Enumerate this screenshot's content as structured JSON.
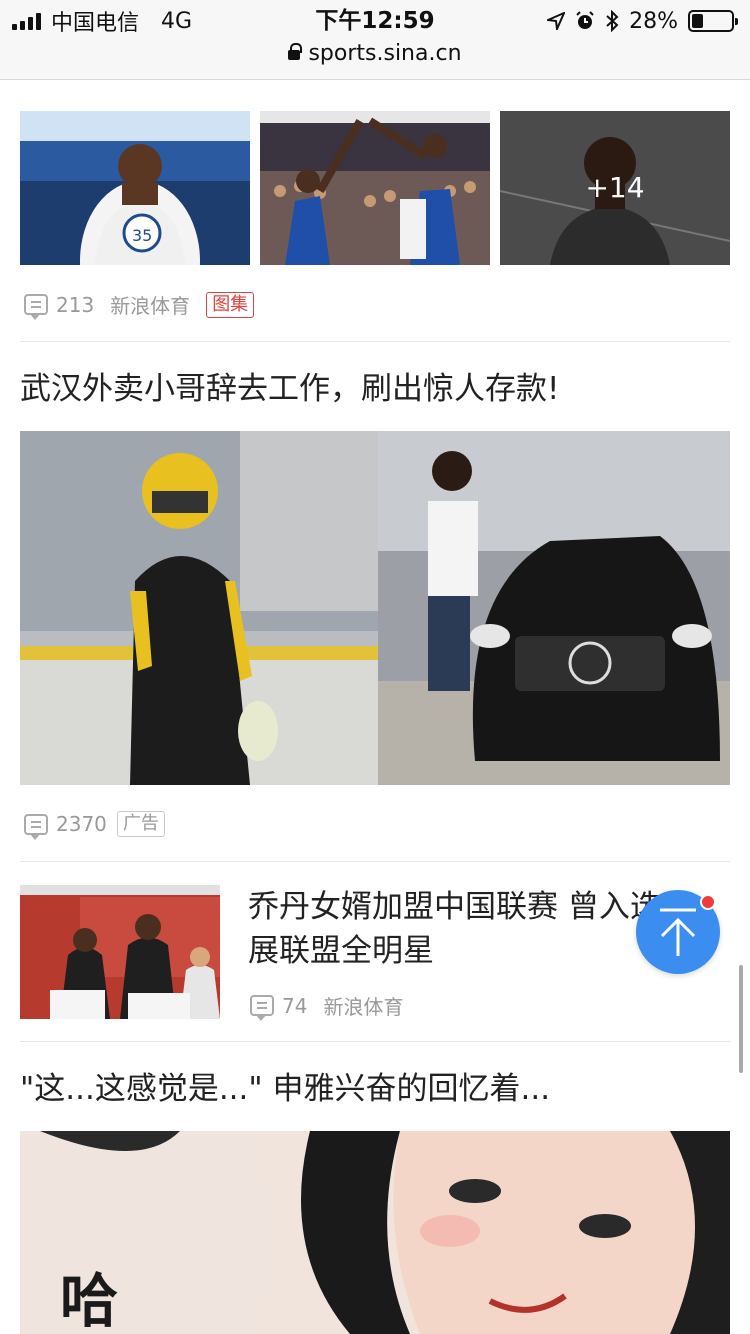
{
  "status": {
    "carrier": "中国电信",
    "network": "4G",
    "time": "下午12:59",
    "battery": "28%",
    "battery_level": 0.28,
    "url": "sports.sina.cn"
  },
  "feed": {
    "clipped_title": "入 图",
    "item1": {
      "more_count": "+14",
      "comments": "213",
      "source": "新浪体育",
      "tag": "图集"
    },
    "item2": {
      "title": "武汉外卖小哥辞去工作，刷出惊人存款!",
      "comments": "2370",
      "tag": "广告"
    },
    "item3": {
      "title": "乔丹女婿加盟中国联赛 曾入选发展联盟全明星",
      "comments": "74",
      "source": "新浪体育"
    },
    "item4": {
      "title": "\"这...这感觉是...\" 申雅兴奋的回忆着..."
    }
  },
  "colors": {
    "accent_blue": "#3b8ef0",
    "badge_red": "#ef3b3b",
    "tag_red": "#e0433e"
  }
}
